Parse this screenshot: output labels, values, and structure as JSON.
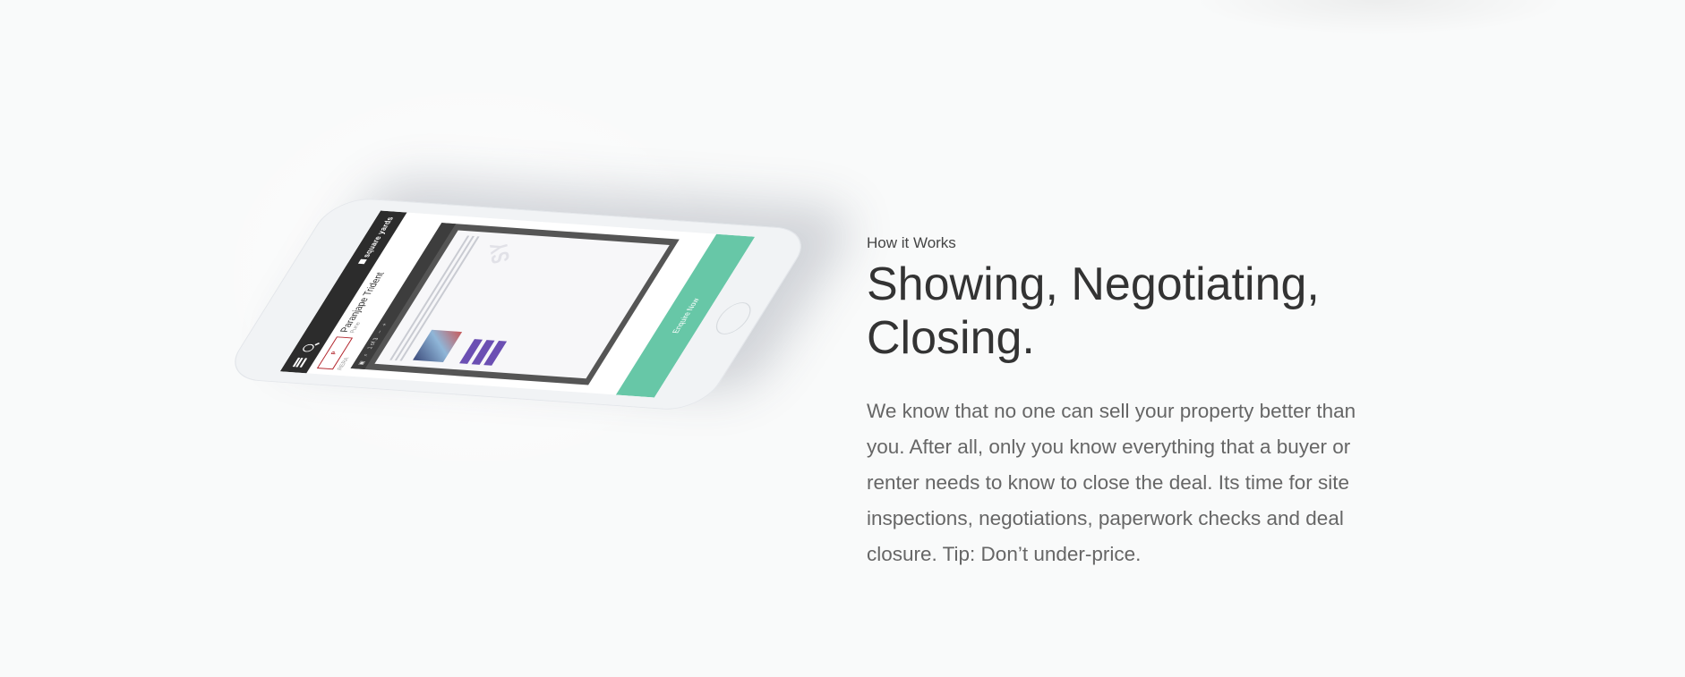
{
  "how_it_works": {
    "eyebrow": "How it Works",
    "heading_line1": "Showing, Negotiating,",
    "heading_line2": "Closing.",
    "paragraph": "We know that no one can sell your property better than you. After all, only you know everything that a buyer or renter needs to know to close the deal. Its time for site inspections, negotiations, paperwork checks and deal closure. Tip: Don’t under-price."
  },
  "phone_screen": {
    "brand": "square yards",
    "listing_title": "Paranjape Trident",
    "listing_subtitle": "Pune",
    "rera": "RERA",
    "page_indicator": "1 of 3",
    "cta": "Enquire Now"
  },
  "colors": {
    "background": "#f9fafa",
    "cta_green": "#67c7a7",
    "appbar_dark": "#2c2c2c",
    "heading_text": "#333333",
    "body_text": "#666666"
  }
}
